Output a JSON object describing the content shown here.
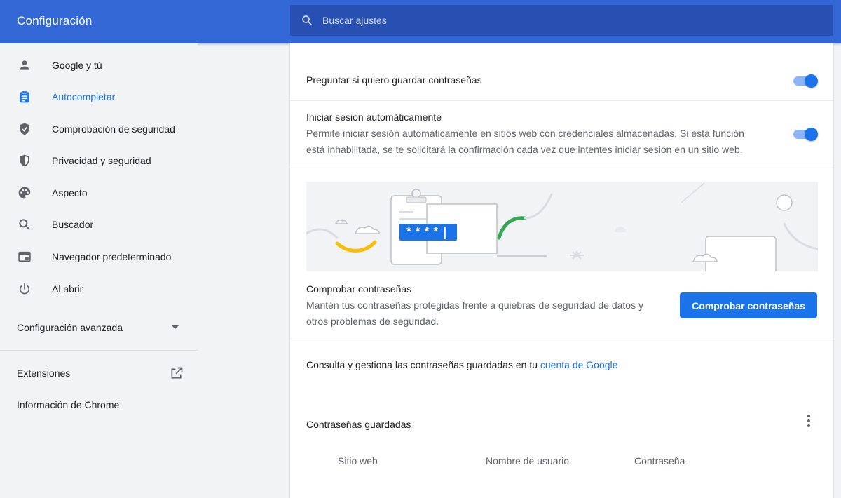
{
  "header": {
    "title": "Configuración",
    "search_placeholder": "Buscar ajustes",
    "search_icon": "search-icon"
  },
  "sidebar": {
    "items": [
      {
        "label": "Google y tú",
        "icon": "person-icon",
        "active": false
      },
      {
        "label": "Autocompletar",
        "icon": "clipboard-icon",
        "active": true
      },
      {
        "label": "Comprobación de seguridad",
        "icon": "shield-check-icon",
        "active": false
      },
      {
        "label": "Privacidad y seguridad",
        "icon": "shield-icon",
        "active": false
      },
      {
        "label": "Aspecto",
        "icon": "palette-icon",
        "active": false
      },
      {
        "label": "Buscador",
        "icon": "search-icon",
        "active": false
      },
      {
        "label": "Navegador predeterminado",
        "icon": "browser-icon",
        "active": false
      },
      {
        "label": "Al abrir",
        "icon": "power-icon",
        "active": false
      }
    ],
    "advanced_label": "Configuración avanzada",
    "extensions_label": "Extensiones",
    "about_label": "Información de Chrome"
  },
  "main": {
    "offer_to_save": {
      "label": "Preguntar si quiero guardar contraseñas",
      "enabled": true
    },
    "auto_signin": {
      "label": "Iniciar sesión automáticamente",
      "description_line1": "Permite iniciar sesión automáticamente en sitios web con credenciales almacenadas. Si esta función",
      "description_line2": "está inhabilitada, se te solicitará la confirmación cada vez que intentes iniciar sesión en un sitio web.",
      "enabled": true
    },
    "illustration": {
      "password_mask": "****|"
    },
    "check_passwords": {
      "label": "Comprobar contraseñas",
      "description_line1": "Mantén tus contraseñas protegidas frente a quiebras de seguridad de datos y",
      "description_line2": "otros problemas de seguridad.",
      "button_label": "Comprobar contraseñas"
    },
    "manage": {
      "text": "Consulta y gestiona las contraseñas guardadas en tu ",
      "link_text": "cuenta de Google"
    },
    "saved_passwords": {
      "title": "Contraseñas guardadas",
      "columns": [
        "Sitio web",
        "Nombre de usuario",
        "Contraseña"
      ]
    }
  },
  "colors": {
    "header_bg": "#3367d6",
    "search_bg": "#2850b2",
    "accent": "#1a73e8",
    "page_bg": "#f1f3f4"
  }
}
